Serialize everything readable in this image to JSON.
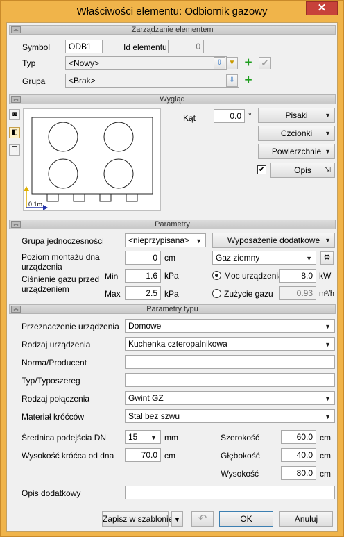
{
  "window": {
    "title": "Właściwości elementu: Odbiornik gazowy",
    "close": "✕"
  },
  "sections": {
    "management": "Zarządzanie elementem",
    "appearance": "Wygląd",
    "parameters": "Parametry",
    "type_parameters": "Parametry typu"
  },
  "management": {
    "symbol_label": "Symbol",
    "symbol_value": "ODB1",
    "id_label": "Id elementu",
    "id_value": "0",
    "type_label": "Typ",
    "type_value": "<Nowy>",
    "group_label": "Grupa",
    "group_value": "<Brak>"
  },
  "appearance": {
    "angle_label": "Kąt",
    "angle_value": "0.0",
    "angle_unit": "°",
    "pens_button": "Pisaki",
    "fonts_button": "Czcionki",
    "surfaces_button": "Powierzchnie",
    "description_checked": true,
    "description_button": "Opis",
    "scale_label": "0.1m"
  },
  "parameters": {
    "unit_group_label": "Grupa jednoczesności",
    "unit_group_value": "<nieprzypisana>",
    "extra_equipment_button": "Wyposażenie dodatkowe",
    "mount_level_label": "Poziom montażu dna urządzenia",
    "mount_level_value": "0",
    "mount_level_unit": "cm",
    "gas_type_value": "Gaz ziemny",
    "pressure_label": "Ciśnienie gazu przed urządzeniem",
    "min_label": "Min",
    "min_value": "1.6",
    "min_unit": "kPa",
    "max_label": "Max",
    "max_value": "2.5",
    "max_unit": "kPa",
    "power_label": "Moc urządzenia",
    "power_value": "8.0",
    "power_unit": "kW",
    "power_selected": true,
    "consumption_label": "Zużycie gazu",
    "consumption_value": "0.93",
    "consumption_unit": "m³/h"
  },
  "type_parameters": {
    "purpose_label": "Przeznaczenie urządzenia",
    "purpose_value": "Domowe",
    "kind_label": "Rodzaj urządzenia",
    "kind_value": "Kuchenka czteropalnikowa",
    "norm_label": "Norma/Producent",
    "norm_value": "",
    "series_label": "Typ/Typoszereg",
    "series_value": "",
    "connection_label": "Rodzaj połączenia",
    "connection_value": "Gwint GZ",
    "material_label": "Materiał króćców",
    "material_value": "Stal bez szwu",
    "diameter_label": "Średnica podejścia DN",
    "diameter_value": "15",
    "diameter_unit": "mm",
    "stub_height_label": "Wysokość króćca od dna",
    "stub_height_value": "70.0",
    "stub_height_unit": "cm",
    "width_label": "Szerokość",
    "width_value": "60.0",
    "width_unit": "cm",
    "depth_label": "Głębokość",
    "depth_value": "40.0",
    "depth_unit": "cm",
    "height_label": "Wysokość",
    "height_value": "80.0",
    "height_unit": "cm",
    "additional_label": "Opis dodatkowy",
    "additional_value": ""
  },
  "footer": {
    "save_template": "Zapisz w szablonie",
    "ok": "OK",
    "cancel": "Anuluj"
  },
  "colors": {
    "frame": "#f0b44a",
    "close": "#c7423a",
    "plus": "#1e9e1e"
  }
}
